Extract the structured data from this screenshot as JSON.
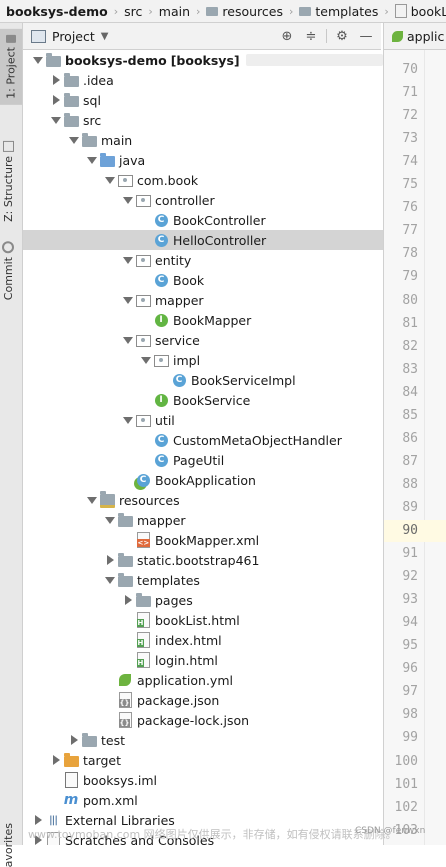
{
  "breadcrumb": [
    "booksys-demo",
    "src",
    "main",
    "resources",
    "templates",
    "bookList.html"
  ],
  "side_tabs": [
    "1: Project",
    "Z: Structure",
    "Commit",
    "avorites"
  ],
  "panel": {
    "title": "Project"
  },
  "editor_tab": "applic",
  "project_suffix": "[booksys]",
  "tree": [
    {
      "label": "booksys-demo",
      "depth": 0,
      "arrow": "down",
      "icon": "folder-plain"
    },
    {
      "label": ".idea",
      "depth": 1,
      "arrow": "right",
      "icon": "folder-plain"
    },
    {
      "label": "sql",
      "depth": 1,
      "arrow": "right",
      "icon": "folder-plain"
    },
    {
      "label": "src",
      "depth": 1,
      "arrow": "down",
      "icon": "folder-plain"
    },
    {
      "label": "main",
      "depth": 2,
      "arrow": "down",
      "icon": "folder-plain"
    },
    {
      "label": "java",
      "depth": 3,
      "arrow": "down",
      "icon": "folder-blue"
    },
    {
      "label": "com.book",
      "depth": 4,
      "arrow": "down",
      "icon": "package"
    },
    {
      "label": "controller",
      "depth": 5,
      "arrow": "down",
      "icon": "package"
    },
    {
      "label": "BookController",
      "depth": 6,
      "arrow": "none",
      "icon": "class"
    },
    {
      "label": "HelloController",
      "depth": 6,
      "arrow": "none",
      "icon": "class",
      "selected": true
    },
    {
      "label": "entity",
      "depth": 5,
      "arrow": "down",
      "icon": "package"
    },
    {
      "label": "Book",
      "depth": 6,
      "arrow": "none",
      "icon": "class"
    },
    {
      "label": "mapper",
      "depth": 5,
      "arrow": "down",
      "icon": "package"
    },
    {
      "label": "BookMapper",
      "depth": 6,
      "arrow": "none",
      "icon": "interface"
    },
    {
      "label": "service",
      "depth": 5,
      "arrow": "down",
      "icon": "package"
    },
    {
      "label": "impl",
      "depth": 6,
      "arrow": "down",
      "icon": "package"
    },
    {
      "label": "BookServiceImpl",
      "depth": 7,
      "arrow": "none",
      "icon": "class"
    },
    {
      "label": "BookService",
      "depth": 6,
      "arrow": "none",
      "icon": "interface"
    },
    {
      "label": "util",
      "depth": 5,
      "arrow": "down",
      "icon": "package"
    },
    {
      "label": "CustomMetaObjectHandler",
      "depth": 6,
      "arrow": "none",
      "icon": "class"
    },
    {
      "label": "PageUtil",
      "depth": 6,
      "arrow": "none",
      "icon": "class"
    },
    {
      "label": "BookApplication",
      "depth": 5,
      "arrow": "none",
      "icon": "spring-class"
    },
    {
      "label": "resources",
      "depth": 3,
      "arrow": "down",
      "icon": "folder-res"
    },
    {
      "label": "mapper",
      "depth": 4,
      "arrow": "down",
      "icon": "folder-plain"
    },
    {
      "label": "BookMapper.xml",
      "depth": 5,
      "arrow": "none",
      "icon": "xml"
    },
    {
      "label": "static.bootstrap461",
      "depth": 4,
      "arrow": "right",
      "icon": "folder-plain"
    },
    {
      "label": "templates",
      "depth": 4,
      "arrow": "down",
      "icon": "folder-plain"
    },
    {
      "label": "pages",
      "depth": 5,
      "arrow": "right",
      "icon": "folder-plain"
    },
    {
      "label": "bookList.html",
      "depth": 5,
      "arrow": "none",
      "icon": "html"
    },
    {
      "label": "index.html",
      "depth": 5,
      "arrow": "none",
      "icon": "html"
    },
    {
      "label": "login.html",
      "depth": 5,
      "arrow": "none",
      "icon": "html"
    },
    {
      "label": "application.yml",
      "depth": 4,
      "arrow": "none",
      "icon": "yml"
    },
    {
      "label": "package.json",
      "depth": 4,
      "arrow": "none",
      "icon": "json"
    },
    {
      "label": "package-lock.json",
      "depth": 4,
      "arrow": "none",
      "icon": "json"
    },
    {
      "label": "test",
      "depth": 2,
      "arrow": "right",
      "icon": "folder-plain"
    },
    {
      "label": "target",
      "depth": 1,
      "arrow": "right",
      "icon": "folder-orange"
    },
    {
      "label": "booksys.iml",
      "depth": 1,
      "arrow": "none",
      "icon": "iml"
    },
    {
      "label": "pom.xml",
      "depth": 1,
      "arrow": "none",
      "icon": "maven"
    },
    {
      "label": "External Libraries",
      "depth": 0,
      "arrow": "right",
      "icon": "libraries"
    },
    {
      "label": "Scratches and Consoles",
      "depth": 0,
      "arrow": "right",
      "icon": "scratches"
    }
  ],
  "line_numbers": [
    70,
    71,
    72,
    73,
    74,
    75,
    76,
    77,
    78,
    79,
    80,
    81,
    82,
    83,
    84,
    85,
    86,
    87,
    88,
    89,
    90,
    91,
    92,
    93,
    94,
    95,
    96,
    97,
    98,
    99,
    100,
    101,
    102,
    103
  ],
  "current_line": 90,
  "watermark": "www.toymoban.com 网络图片仅供展示，非存储，如有侵权请联系删除。",
  "watermark2": "CSDN @fenwxn"
}
